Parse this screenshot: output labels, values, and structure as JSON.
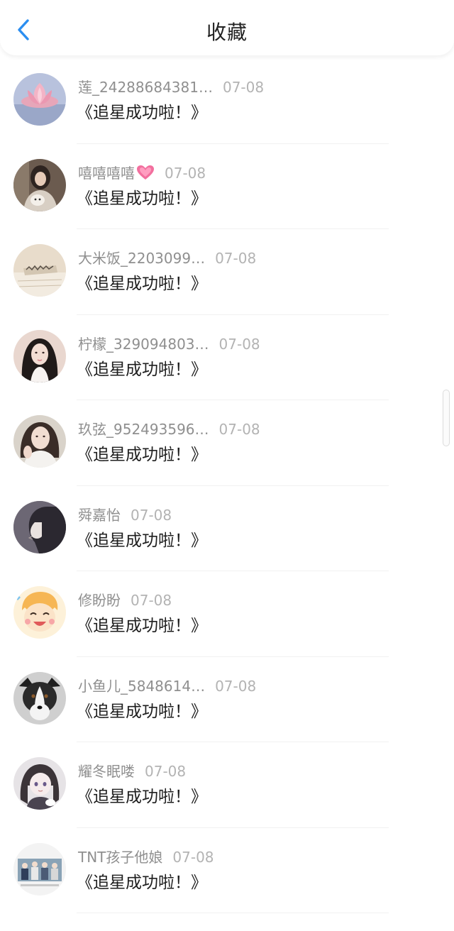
{
  "header": {
    "title": "收藏",
    "back_icon": "chevron-left-icon",
    "accent_color": "#2b8ef0"
  },
  "items": [
    {
      "username": "莲_24288684381…",
      "date": "07-08",
      "content": "《追星成功啦！》",
      "avatar": "lotus-flower-avatar"
    },
    {
      "username": "嘻嘻嘻嘻",
      "date": "07-08",
      "content": "《追星成功啦！》",
      "avatar": "girl-with-dog-avatar",
      "emoji": "pink-heart-icon"
    },
    {
      "username": "大米饭_2203099…",
      "date": "07-08",
      "content": "《追星成功啦！》",
      "avatar": "paper-sketch-avatar"
    },
    {
      "username": "柠檬_329094803…",
      "date": "07-08",
      "content": "《追星成功啦！》",
      "avatar": "girl-portrait-avatar"
    },
    {
      "username": "玖弦_952493596…",
      "date": "07-08",
      "content": "《追星成功啦！》",
      "avatar": "girl-selfie-avatar"
    },
    {
      "username": "舜嘉怡",
      "date": "07-08",
      "content": "《追星成功啦！》",
      "avatar": "anime-profile-avatar"
    },
    {
      "username": "修盼盼",
      "date": "07-08",
      "content": "《追星成功啦！》",
      "avatar": "cartoon-boy-avatar"
    },
    {
      "username": "小鱼儿_5848614…",
      "date": "07-08",
      "content": "《追星成功啦！》",
      "avatar": "puppy-avatar"
    },
    {
      "username": "耀冬眠喽",
      "date": "07-08",
      "content": "《追星成功啦！》",
      "avatar": "anime-girl-avatar"
    },
    {
      "username": "TNT孩子他娘",
      "date": "07-08",
      "content": "《追星成功啦！》",
      "avatar": "group-photo-avatar"
    }
  ]
}
